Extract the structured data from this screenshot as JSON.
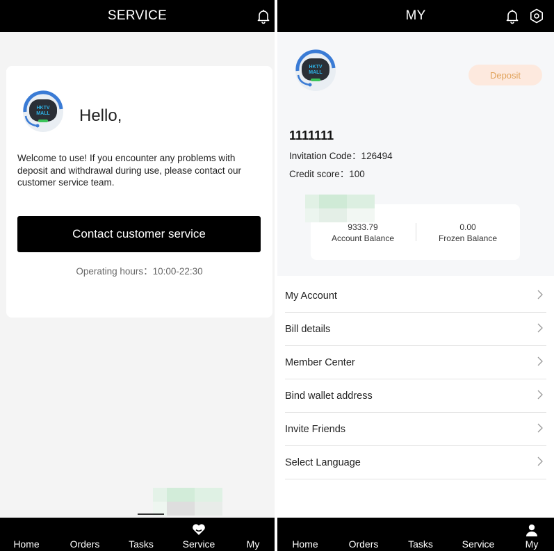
{
  "left": {
    "header": {
      "title": "SERVICE",
      "bell_icon": "bell-icon"
    },
    "card": {
      "greeting": "Hello,",
      "message": "Welcome to use! If you encounter any problems with deposit and withdrawal during use, please contact our customer service team.",
      "contact_label": "Contact customer service",
      "hours": "Operating hours：10:00-22:30",
      "avatar_logo": [
        "HKTV",
        "MALL"
      ]
    },
    "tabbar": {
      "tabs": [
        "Home",
        "Orders",
        "Tasks",
        "Service",
        "My"
      ],
      "active_icon": "heart-icon"
    }
  },
  "right": {
    "header": {
      "title": "MY",
      "bell_icon": "bell-icon",
      "settings_icon": "gear-icon"
    },
    "profile": {
      "avatar_logo": [
        "HKTV",
        "MALL"
      ],
      "deposit_label": "Deposit",
      "username": "1111111",
      "invitation": "Invitation Code：126494",
      "credit": "Credit score：100"
    },
    "balance": {
      "account_value": "9333.79",
      "account_label": "Account Balance",
      "frozen_value": "0.00",
      "frozen_label": "Frozen Balance"
    },
    "menu": [
      "My Account",
      "Bill details",
      "Member Center",
      "Bind wallet address",
      "Invite Friends",
      "Select Language"
    ],
    "tabbar": {
      "tabs": [
        "Home",
        "Orders",
        "Tasks",
        "Service",
        "My"
      ],
      "active_icon": "user-icon"
    }
  },
  "colors": {
    "bar": "#000000",
    "deposit_bg": "#fde9de",
    "deposit_text": "#e0a158",
    "avatar_ring": "#3a7bd5",
    "logo_text": "#2fb4e8"
  }
}
